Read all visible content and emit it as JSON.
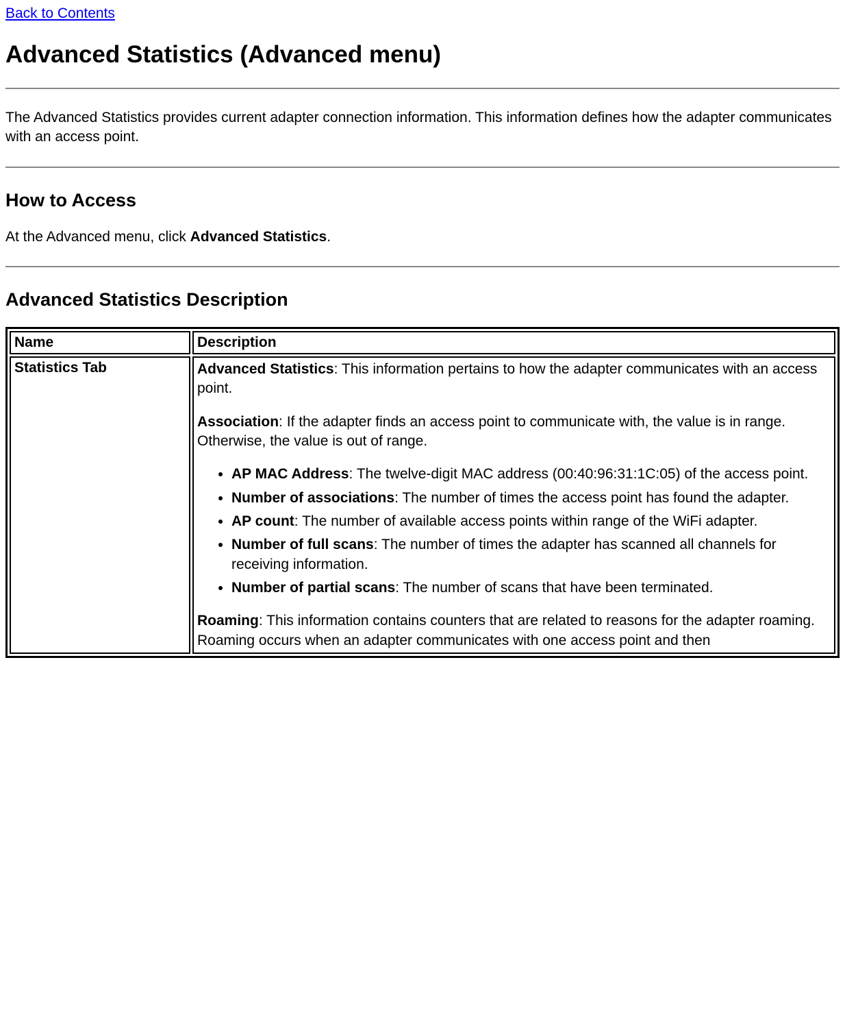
{
  "back_link": "Back to Contents",
  "title": "Advanced Statistics (Advanced menu)",
  "intro": "The Advanced Statistics provides current adapter connection information. This information defines how the adapter communicates with an access point.",
  "how_to_access_heading": "How to Access",
  "how_to_access_text_prefix": "At the Advanced menu, click ",
  "how_to_access_bold": "Advanced Statistics",
  "how_to_access_text_suffix": ".",
  "description_heading": "Advanced Statistics Description",
  "table": {
    "header_name": "Name",
    "header_description": "Description",
    "row1_name": "Statistics Tab",
    "row1_desc": {
      "adv_stats_label": "Advanced Statistics",
      "adv_stats_text": ": This information pertains to how the adapter communicates with an access point.",
      "association_label": "Association",
      "association_text": ": If the adapter finds an access point to communicate with, the value is in range. Otherwise, the value is out of range.",
      "bullets": [
        {
          "label": "AP MAC Address",
          "text": ": The twelve-digit MAC address (00:40:96:31:1C:05) of the access point."
        },
        {
          "label": "Number of associations",
          "text": ": The number of times the access point has found the adapter."
        },
        {
          "label": "AP count",
          "text": ": The number of available access points within range of the WiFi adapter."
        },
        {
          "label": "Number of full scans",
          "text": ": The number of times the adapter has scanned all channels for receiving information."
        },
        {
          "label": "Number of partial scans",
          "text": ": The number of scans that have been terminated."
        }
      ],
      "roaming_label": "Roaming",
      "roaming_text": ": This information contains counters that are related to reasons for the adapter roaming. Roaming occurs when an adapter communicates with one access point and then"
    }
  }
}
